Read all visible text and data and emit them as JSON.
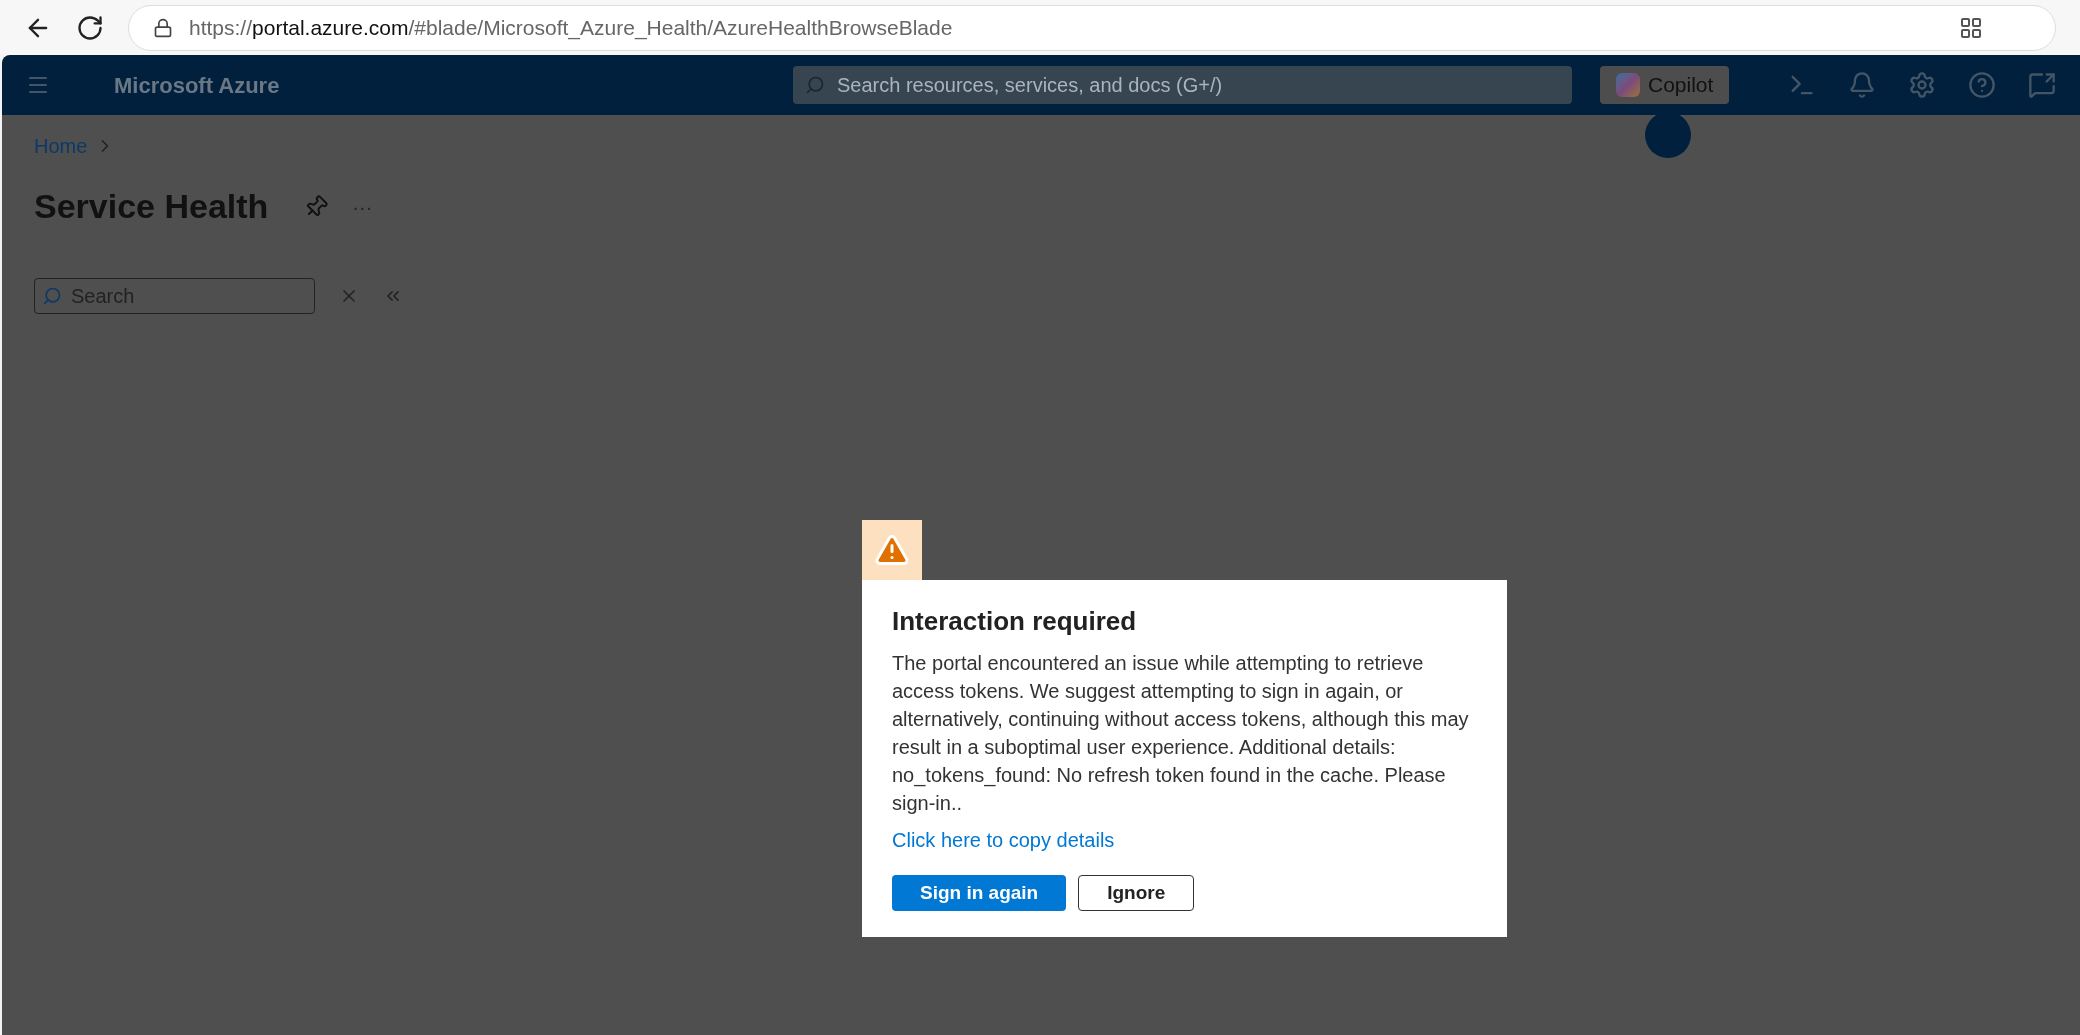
{
  "browser": {
    "url": {
      "scheme": "https://",
      "host": "portal.azure.com",
      "path": "/#blade/Microsoft_Azure_Health/AzureHealthBrowseBlade"
    }
  },
  "header": {
    "brand": "Microsoft Azure",
    "search": {
      "placeholder": "Search resources, services, and docs (G+/)"
    },
    "copilot": "Copilot"
  },
  "breadcrumb": [
    "Home"
  ],
  "page": {
    "title": "Service Health",
    "more": "···"
  },
  "filter": {
    "placeholder": "Search"
  },
  "dialog": {
    "title": "Interaction required",
    "message": "The portal encountered an issue while attempting to retrieve access tokens. We suggest attempting to sign in again, or alternatively, continuing without access tokens, although this may result in a suboptimal user experience. Additional details: no_tokens_found: No refresh token found in the cache. Please sign-in..",
    "link": "Click here to copy details",
    "buttons": [
      {
        "label": "Sign in again",
        "kind": "primary"
      },
      {
        "label": "Ignore",
        "kind": "secondary"
      }
    ]
  }
}
